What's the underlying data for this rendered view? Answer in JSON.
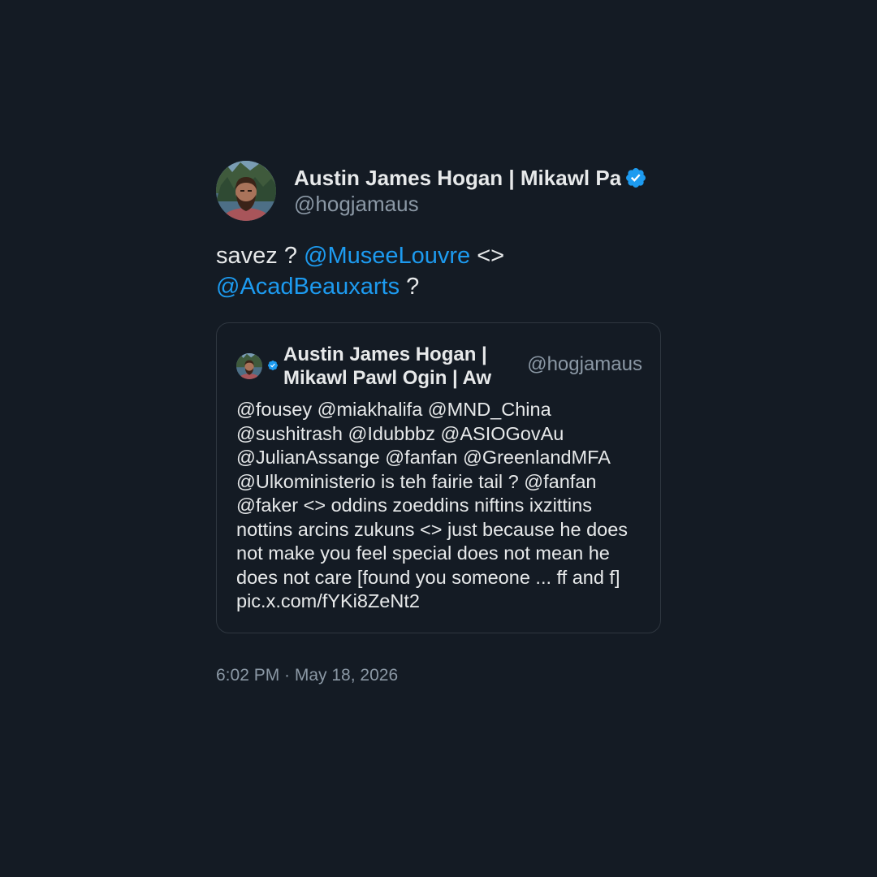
{
  "tweet": {
    "author": {
      "display_name": "Austin James Hogan | Mikawl Pa",
      "handle": "@hogjamaus",
      "verified": true,
      "avatar_icon": "profile-photo"
    },
    "text": {
      "prefix": "savez ? ",
      "mention_1": "@MuseeLouvre",
      "middle": " <> ",
      "mention_2": "@AcadBeauxarts",
      "suffix": " ?"
    },
    "quoted": {
      "author": {
        "display_name": "Austin James Hogan | Mikawl Pawl Ogin | Aw",
        "handle": "@hogjamaus",
        "verified": true
      },
      "text": "@fousey @miakhalifa @MND_China @sushitrash @Idubbbz @ASIOGovAu @JulianAssange @fanfan @GreenlandMFA @Ulkoministerio is teh fairie tail ? @fanfan @faker <> oddins zoeddins niftins ixzittins nottins arcins zukuns <> just because he does not make you feel special does not mean he does not care [found you someone ... ff and f] pic.x.com/fYKi8ZeNt2"
    },
    "timestamp": "6:02 PM · May 18, 2026"
  },
  "colors": {
    "background": "#141b24",
    "text": "#e7e9ea",
    "secondary_text": "#8b98a5",
    "link": "#1d9bf0",
    "border": "#2f3740"
  }
}
